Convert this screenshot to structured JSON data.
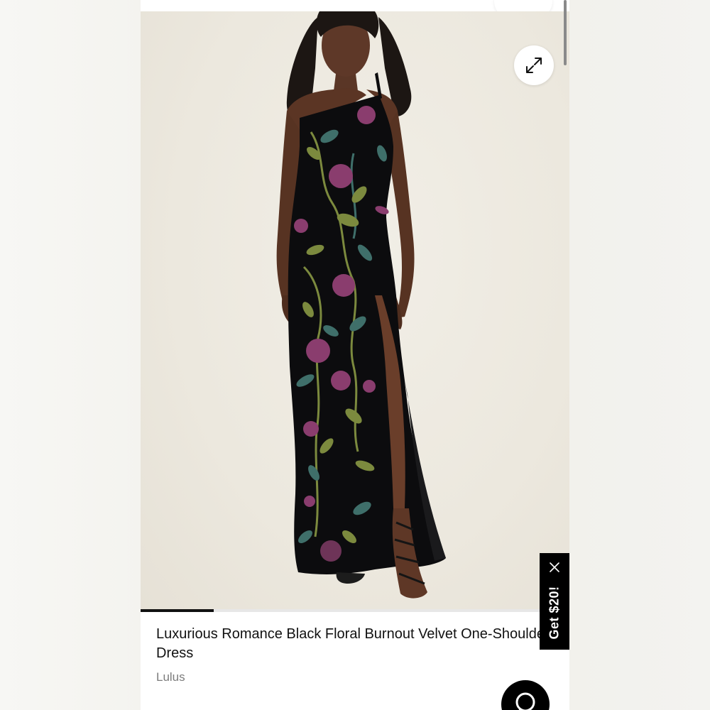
{
  "product": {
    "title": "Luxurious Romance Black Floral Burnout Velvet One-Shoulder Dress",
    "brand": "Lulus"
  },
  "gallery": {
    "image_alt": "Model wearing black floral burnout velvet one-shoulder maxi dress",
    "expand_icon": "expand-arrows-icon",
    "progress_fraction": 0.17
  },
  "promo": {
    "label": "Get $20!",
    "close_icon": "close-icon"
  },
  "chat": {
    "icon": "chat-bubble-icon"
  },
  "colors": {
    "background": "#f6f6f3",
    "text": "#111111",
    "muted_text": "#7c7c7c",
    "promo_bg": "#000000",
    "dress": "#0c0c0e",
    "flower_purple": "#8a3d6e",
    "leaf_green": "#7c8a3e",
    "leaf_teal": "#3f6f6a"
  }
}
